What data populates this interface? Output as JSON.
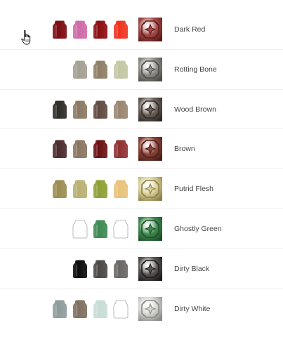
{
  "paints": [
    {
      "name": "Dark Red",
      "pots": [
        "#7a0b10",
        "#cf6aa8",
        "#8c0d10",
        "#ef3320"
      ],
      "swatch": "#a34a47",
      "swatch_detail": "#5e1a1a"
    },
    {
      "name": "Rotting Bone",
      "pots": [
        "#a39f93",
        "#8e7e66",
        "#c3c7a3"
      ],
      "swatch": "#8f8d86",
      "swatch_detail": "#4e4c48"
    },
    {
      "name": "Wood Brown",
      "pots": [
        "#2d2b26",
        "#8a7863",
        "#5f4b40",
        "#9a8570"
      ],
      "swatch": "#6b6058",
      "swatch_detail": "#2f2a27"
    },
    {
      "name": "Brown",
      "pots": [
        "#4a2a2c",
        "#8a7560",
        "#6a1014",
        "#8f3133"
      ],
      "swatch": "#8e4338",
      "swatch_detail": "#4a1f1a"
    },
    {
      "name": "Putrid Flesh",
      "pots": [
        "#9b8c50",
        "#b8b072",
        "#8f9f35",
        "#e8c27a"
      ],
      "swatch": "#d9cf96",
      "swatch_detail": "#8c7f4a"
    },
    {
      "name": "Ghostly Green",
      "pots": [
        "#ffffff",
        "#3d8a53",
        "#ffffff"
      ],
      "swatch": "#3f8a4e",
      "swatch_detail": "#1f4f2a"
    },
    {
      "name": "Dirty Black",
      "pots": [
        "#0b0b0b",
        "#4a4744",
        "#6a6663"
      ],
      "swatch": "#5a5654",
      "swatch_detail": "#1e1c1b"
    },
    {
      "name": "Dirty White",
      "pots": [
        "#8e9b9b",
        "#7f6f60",
        "#c7ddd6",
        "#ffffff"
      ],
      "swatch": "#d5d5d2",
      "swatch_detail": "#8a8a86"
    }
  ]
}
